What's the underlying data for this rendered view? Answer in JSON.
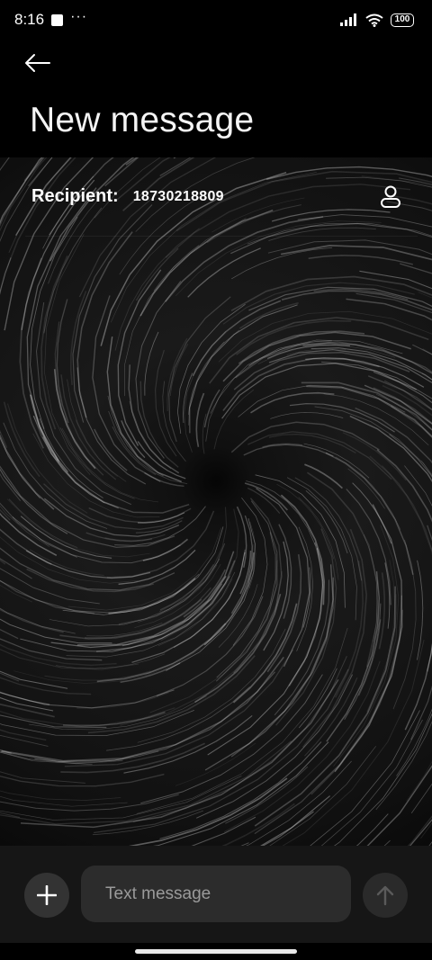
{
  "status_bar": {
    "time": "8:16",
    "dots": "···",
    "battery": "100"
  },
  "header": {
    "back_icon": "arrow-left-icon",
    "title": "New message"
  },
  "recipient": {
    "label": "Recipient:",
    "value": "18730218809",
    "contact_icon": "person-icon"
  },
  "composer": {
    "add_icon": "plus-icon",
    "placeholder": "Text message",
    "value": "",
    "send_icon": "arrow-up-icon"
  },
  "colors": {
    "background": "#000000",
    "composer_bg": "#161616",
    "input_bg": "#2c2c2c",
    "add_button_bg": "#333333",
    "send_button_bg": "#2a2a2a",
    "placeholder": "#9a9a9a"
  }
}
